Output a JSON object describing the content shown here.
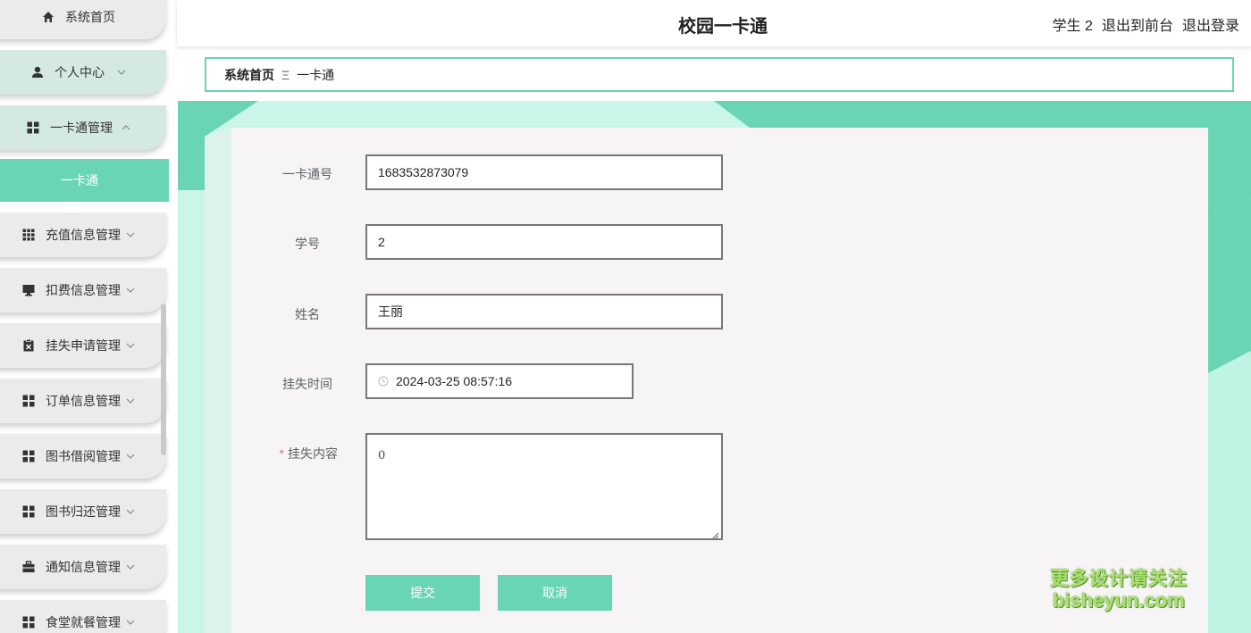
{
  "header": {
    "title": "校园一卡通",
    "user_label": "学生 2",
    "to_front_label": "退出到前台",
    "logout_label": "退出登录"
  },
  "breadcrumb": {
    "home": "系统首页",
    "separator": "Ξ",
    "current": "一卡通"
  },
  "sidebar": {
    "items": [
      {
        "label": "系统首页",
        "icon": "home-icon"
      },
      {
        "label": "个人中心",
        "icon": "user-icon"
      },
      {
        "label": "一卡通管理",
        "icon": "grid-icon"
      },
      {
        "label": "充值信息管理",
        "icon": "grid9-icon"
      },
      {
        "label": "扣费信息管理",
        "icon": "monitor-icon"
      },
      {
        "label": "挂失申请管理",
        "icon": "clipboard-x-icon"
      },
      {
        "label": "订单信息管理",
        "icon": "grid-icon"
      },
      {
        "label": "图书借阅管理",
        "icon": "grid-icon"
      },
      {
        "label": "图书归还管理",
        "icon": "grid-icon"
      },
      {
        "label": "通知信息管理",
        "icon": "briefcase-icon"
      },
      {
        "label": "食堂就餐管理",
        "icon": "grid-icon"
      }
    ],
    "active_sub": "一卡通"
  },
  "form": {
    "card_no_label": "一卡通号",
    "card_no_value": "1683532873079",
    "student_no_label": "学号",
    "student_no_value": "2",
    "name_label": "姓名",
    "name_value": "王丽",
    "loss_time_label": "挂失时间",
    "loss_time_value": "2024-03-25 08:57:16",
    "loss_content_label": "挂失内容",
    "loss_content_required": "*",
    "loss_content_value": "0",
    "submit_label": "提交",
    "cancel_label": "取消"
  },
  "watermark": {
    "line1": "更多设计请关注",
    "line2": "bisheyun.com"
  },
  "colors": {
    "accent": "#6ad5b5",
    "sidebar_item_bg": "#ebebeb",
    "content_bg": "#c9f6e8",
    "card_bg": "#f6f4f4"
  }
}
